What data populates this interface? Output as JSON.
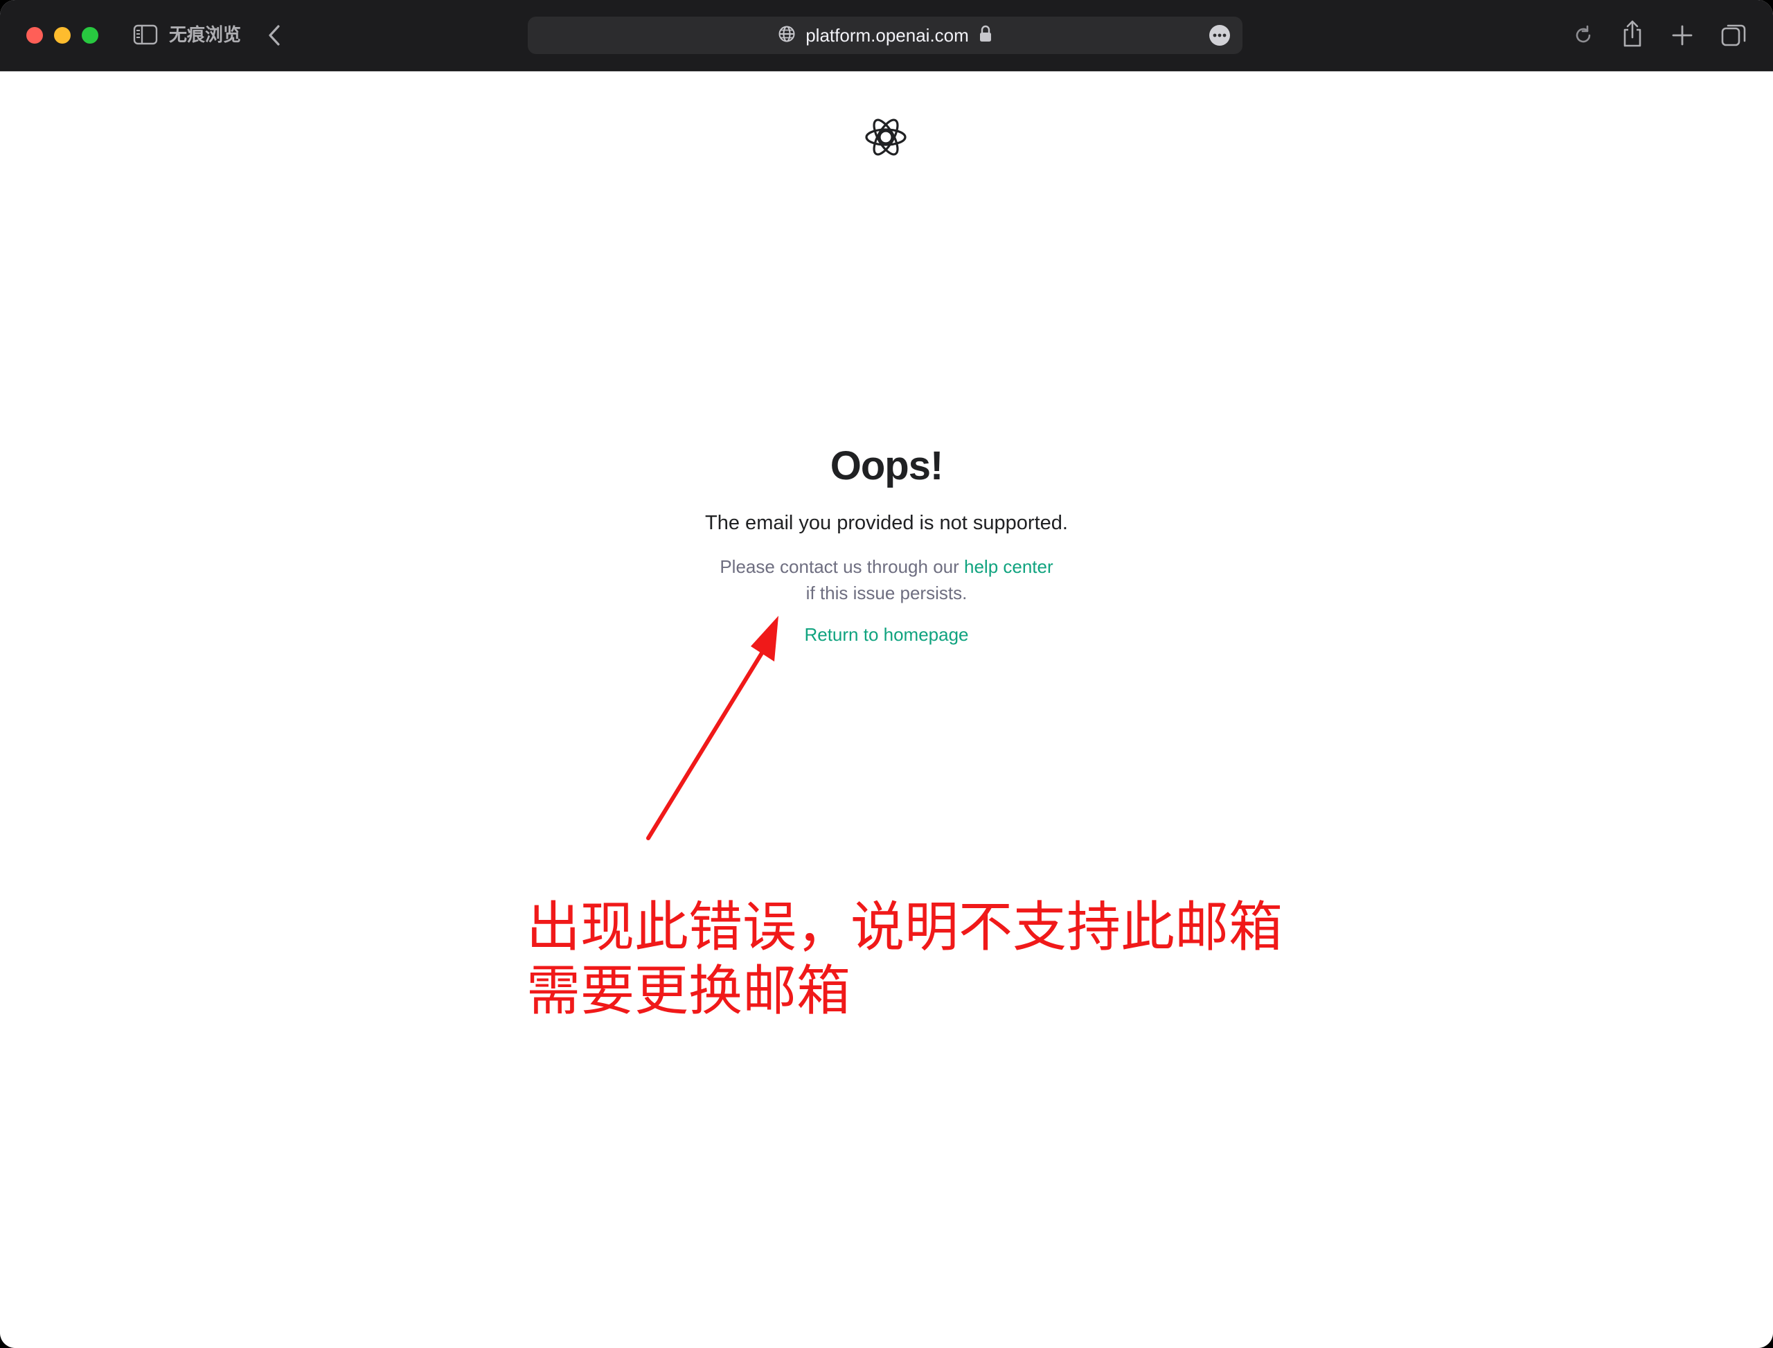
{
  "browser": {
    "private_label": "无痕浏览",
    "url": "platform.openai.com"
  },
  "page": {
    "title": "Oops!",
    "message": "The email you provided is not supported.",
    "help_prefix": "Please contact us through our ",
    "help_link": "help center",
    "help_suffix": "if this issue persists.",
    "return_link": "Return to homepage",
    "link_color": "#10a37f"
  },
  "annotation": {
    "line1": "出现此错误，说明不支持此邮箱",
    "line2": "需要更换邮箱",
    "color": "#f01919"
  }
}
